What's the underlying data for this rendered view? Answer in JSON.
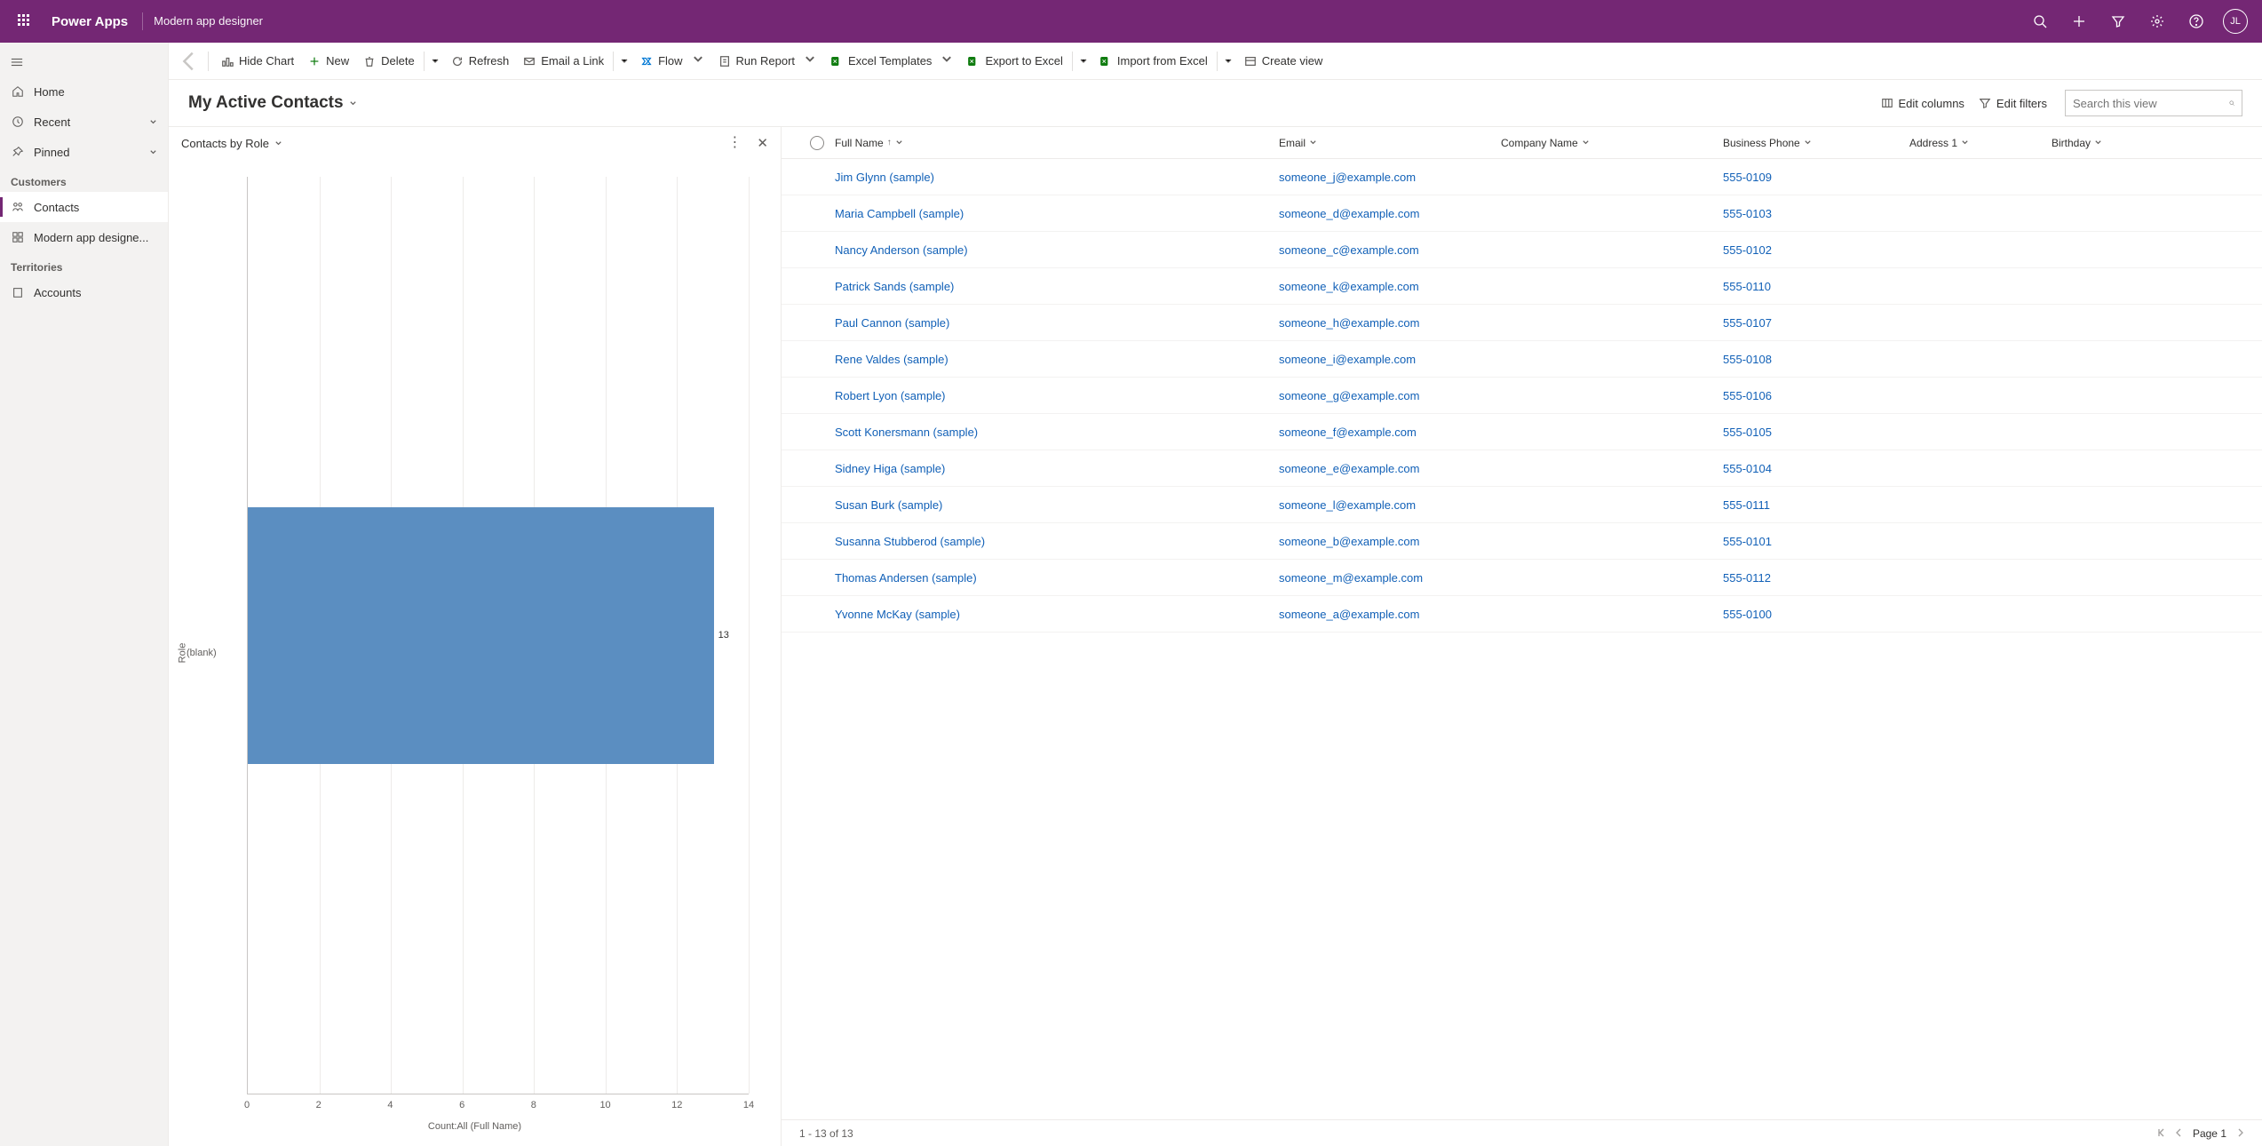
{
  "titlebar": {
    "brand": "Power Apps",
    "designer": "Modern app designer",
    "avatar": "JL"
  },
  "nav": {
    "home": "Home",
    "recent": "Recent",
    "pinned": "Pinned",
    "group_customers": "Customers",
    "contacts": "Contacts",
    "modern_app": "Modern app designe...",
    "group_territories": "Territories",
    "accounts": "Accounts"
  },
  "cmd": {
    "hidechart": "Hide Chart",
    "new": "New",
    "delete": "Delete",
    "refresh": "Refresh",
    "emaillink": "Email a Link",
    "flow": "Flow",
    "runreport": "Run Report",
    "exceltpl": "Excel Templates",
    "export": "Export to Excel",
    "import": "Import from Excel",
    "createview": "Create view"
  },
  "view": {
    "title": "My Active Contacts",
    "editcols": "Edit columns",
    "editfilters": "Edit filters",
    "search_placeholder": "Search this view"
  },
  "chart": {
    "title": "Contacts by Role",
    "ylabel": "Role",
    "blank_label": "(blank)",
    "data_label": "13",
    "xlabel": "Count:All (Full Name)"
  },
  "grid": {
    "cols": {
      "name": "Full Name",
      "email": "Email",
      "company": "Company Name",
      "phone": "Business Phone",
      "addr": "Address 1",
      "bday": "Birthday"
    },
    "rows": [
      {
        "name": "Jim Glynn (sample)",
        "email": "someone_j@example.com",
        "phone": "555-0109"
      },
      {
        "name": "Maria Campbell (sample)",
        "email": "someone_d@example.com",
        "phone": "555-0103"
      },
      {
        "name": "Nancy Anderson (sample)",
        "email": "someone_c@example.com",
        "phone": "555-0102"
      },
      {
        "name": "Patrick Sands (sample)",
        "email": "someone_k@example.com",
        "phone": "555-0110"
      },
      {
        "name": "Paul Cannon (sample)",
        "email": "someone_h@example.com",
        "phone": "555-0107"
      },
      {
        "name": "Rene Valdes (sample)",
        "email": "someone_i@example.com",
        "phone": "555-0108"
      },
      {
        "name": "Robert Lyon (sample)",
        "email": "someone_g@example.com",
        "phone": "555-0106"
      },
      {
        "name": "Scott Konersmann (sample)",
        "email": "someone_f@example.com",
        "phone": "555-0105"
      },
      {
        "name": "Sidney Higa (sample)",
        "email": "someone_e@example.com",
        "phone": "555-0104"
      },
      {
        "name": "Susan Burk (sample)",
        "email": "someone_l@example.com",
        "phone": "555-0111"
      },
      {
        "name": "Susanna Stubberod (sample)",
        "email": "someone_b@example.com",
        "phone": "555-0101"
      },
      {
        "name": "Thomas Andersen (sample)",
        "email": "someone_m@example.com",
        "phone": "555-0112"
      },
      {
        "name": "Yvonne McKay (sample)",
        "email": "someone_a@example.com",
        "phone": "555-0100"
      }
    ]
  },
  "pager": {
    "range": "1 - 13 of 13",
    "page": "Page 1"
  },
  "chart_data": {
    "type": "bar",
    "orientation": "horizontal",
    "categories": [
      "(blank)"
    ],
    "values": [
      13
    ],
    "xlabel": "Count:All (Full Name)",
    "ylabel": "Role",
    "xlim": [
      0,
      14
    ],
    "xticks": [
      0,
      2,
      4,
      6,
      8,
      10,
      12,
      14
    ],
    "title": "Contacts by Role"
  }
}
